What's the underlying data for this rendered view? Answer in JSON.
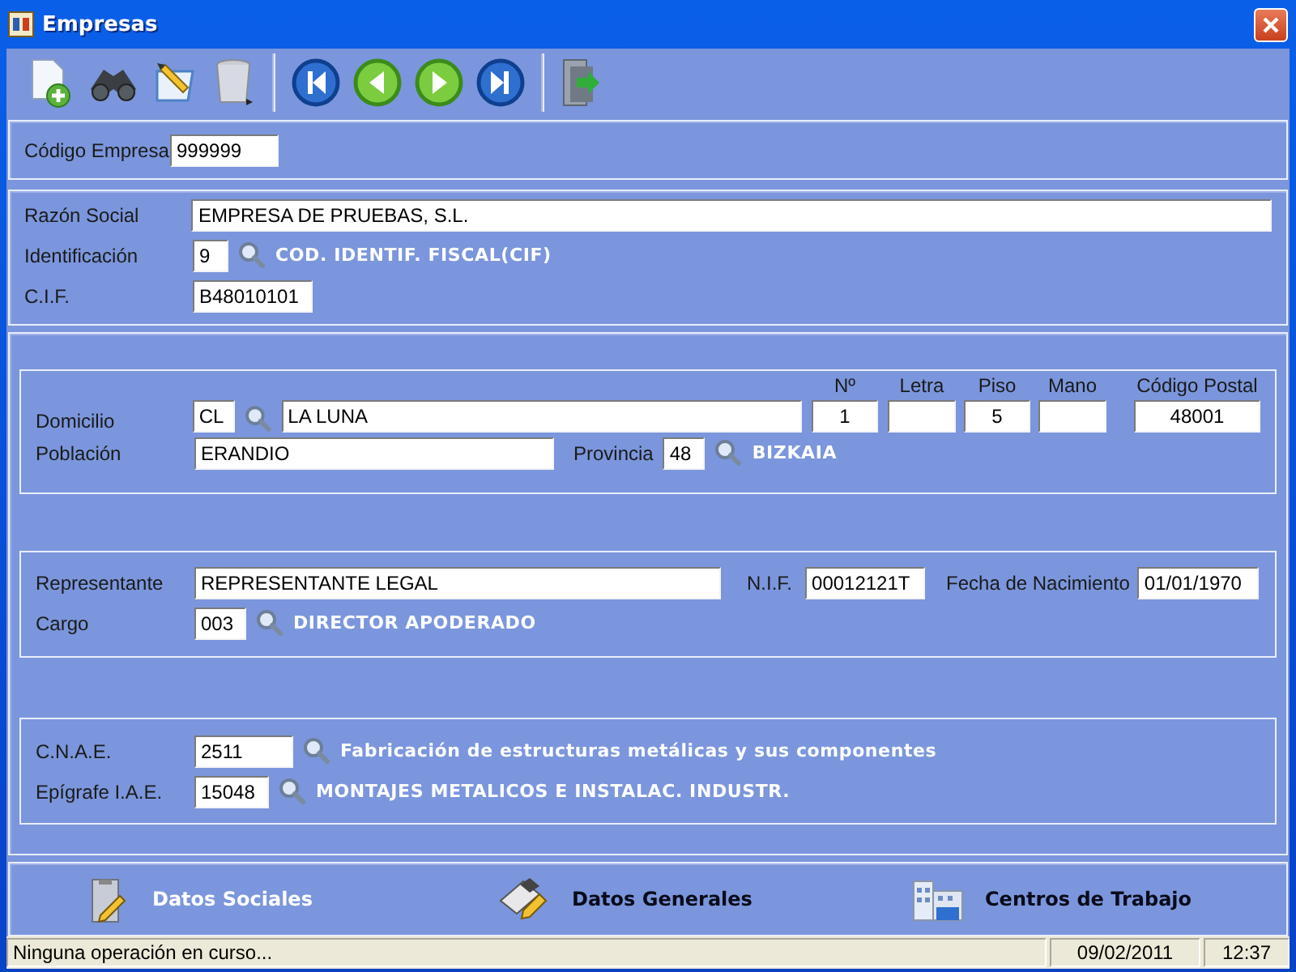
{
  "window": {
    "title": "Empresas"
  },
  "company": {
    "code": {
      "label": "Código Empresa",
      "value": "999999"
    }
  },
  "identity": {
    "business_name": {
      "label": "Razón Social",
      "value": "EMPRESA DE PRUEBAS, S.L."
    },
    "identification": {
      "label": "Identificación",
      "value": "9",
      "description": "COD. IDENTIF. FISCAL(CIF)"
    },
    "tax_id": {
      "label": "C.I.F.",
      "value": "B48010101"
    }
  },
  "address": {
    "street": {
      "label": "Domicilio",
      "type_value": "CL",
      "value": "LA LUNA"
    },
    "number": {
      "label": "Nº",
      "value": "1"
    },
    "letter": {
      "label": "Letra"
    },
    "floor": {
      "label": "Piso",
      "value": "5"
    },
    "door": {
      "label": "Mano"
    },
    "postal_code": {
      "label": "Código Postal",
      "value": "48001"
    },
    "town": {
      "label": "Población",
      "value": "ERANDIO"
    },
    "province": {
      "label": "Provincia",
      "value": "48",
      "description": "BIZKAIA"
    }
  },
  "representative": {
    "name": {
      "label": "Representante",
      "value": "REPRESENTANTE LEGAL"
    },
    "nif": {
      "label": "N.I.F.",
      "value": "00012121T"
    },
    "birth_date": {
      "label": "Fecha de Nacimiento",
      "value": "01/01/1970"
    },
    "position": {
      "label": "Cargo",
      "value": "003",
      "description": "DIRECTOR APODERADO"
    }
  },
  "activity": {
    "cnae": {
      "label": "C.N.A.E.",
      "value": "2511",
      "description": "Fabricación de estructuras metálicas y sus componentes"
    },
    "iae": {
      "label": "Epígrafe I.A.E.",
      "value": "15048",
      "description": "MONTAJES METALICOS E INSTALAC. INDUSTR."
    }
  },
  "tabs": [
    {
      "label": "Datos Sociales",
      "kind": "social",
      "selected": true
    },
    {
      "label": "Datos Generales",
      "kind": "general",
      "selected": false
    },
    {
      "label": "Centros de Trabajo",
      "kind": "workplaces",
      "selected": false
    }
  ],
  "status_bar": {
    "message": "Ninguna operación en curso...",
    "date": "09/02/2011",
    "time": "12:37"
  }
}
